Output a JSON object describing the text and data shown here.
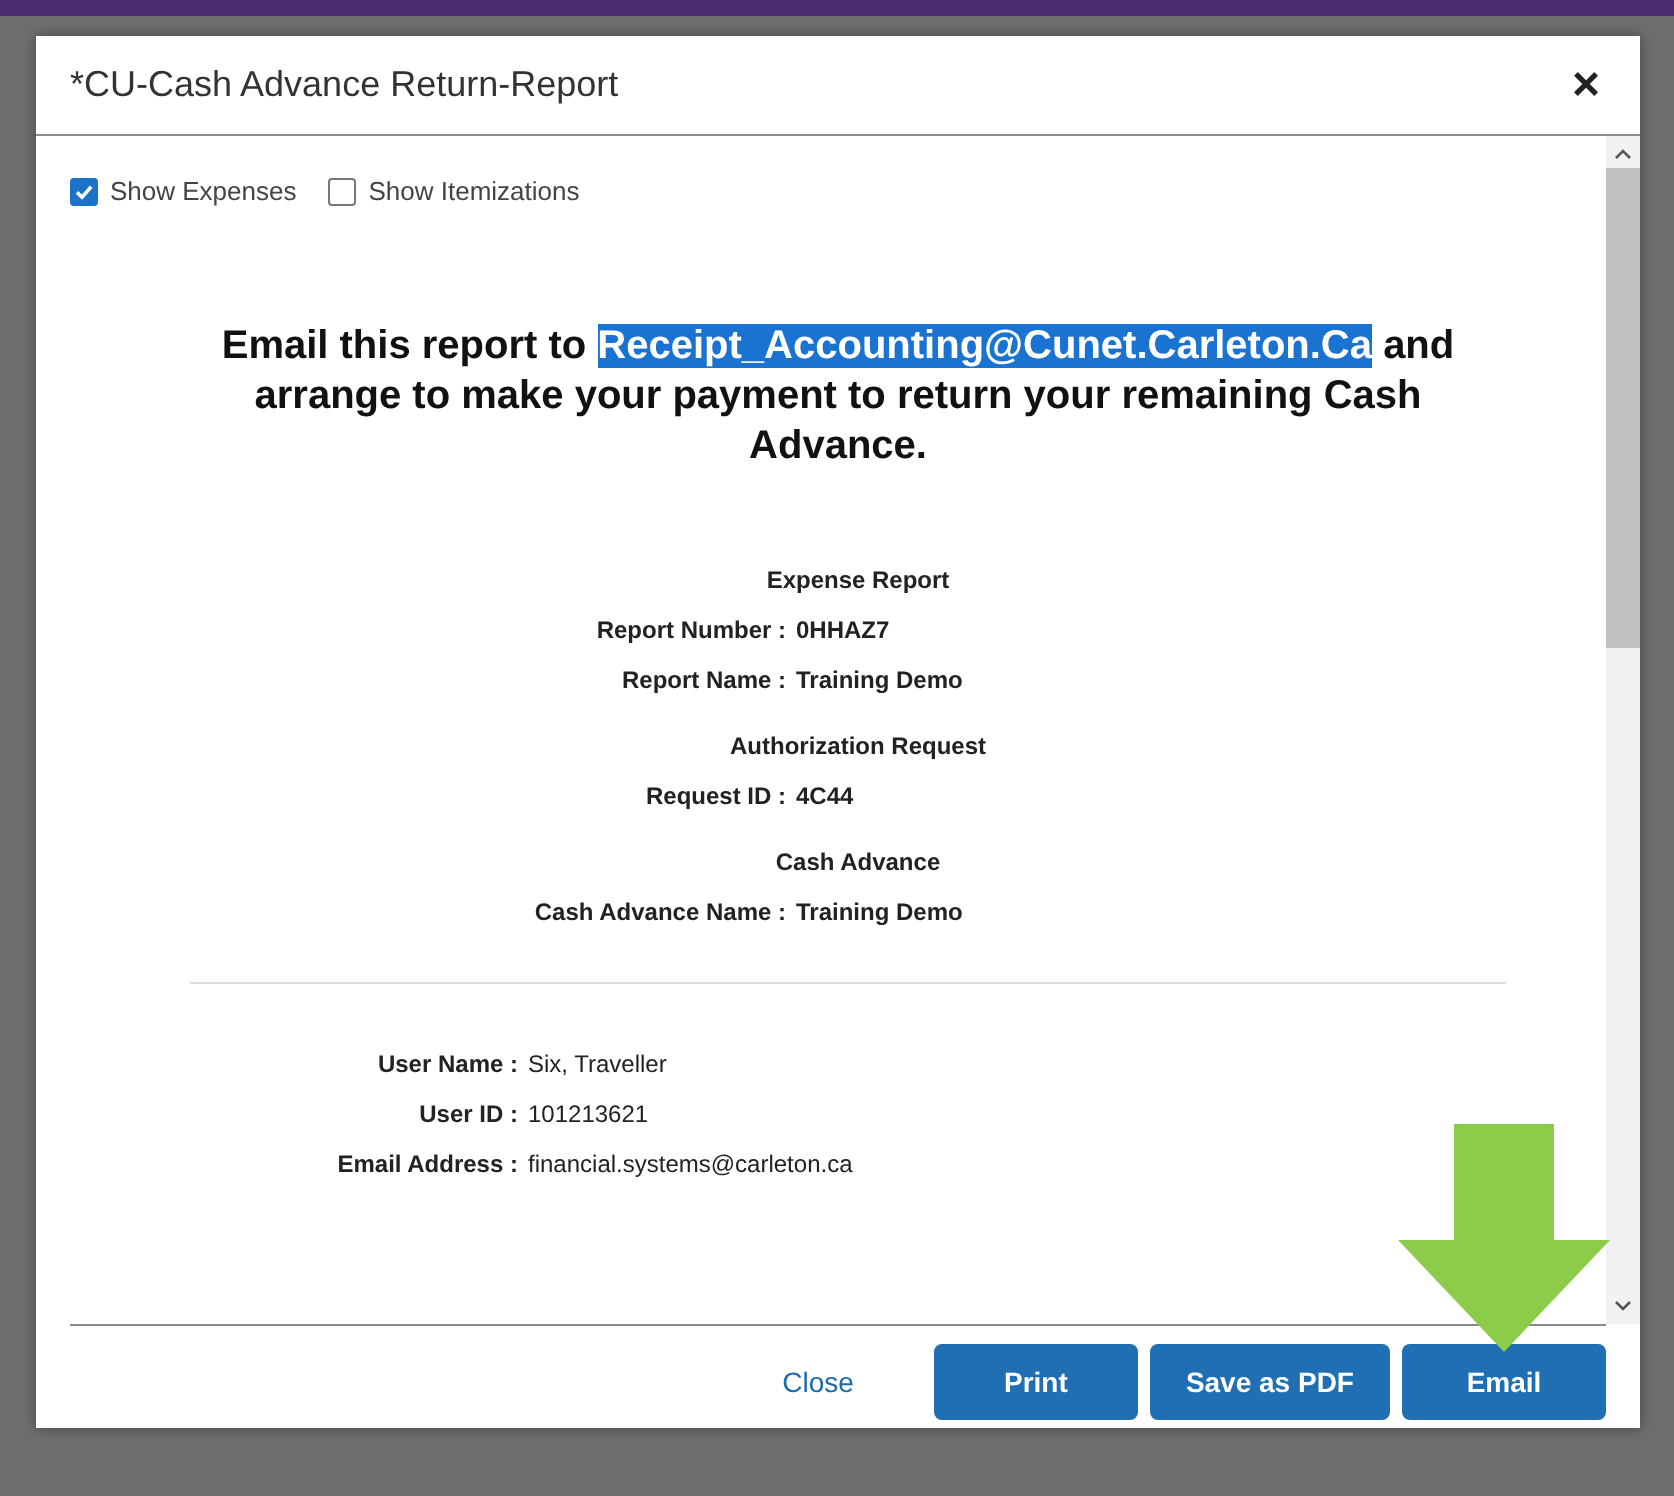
{
  "dialog": {
    "title": "*CU-Cash Advance Return-Report",
    "close": "×"
  },
  "options": [
    {
      "label": "Show Expenses",
      "checked": true
    },
    {
      "label": "Show Itemizations",
      "checked": false
    }
  ],
  "notice": {
    "before": "Email this report to",
    "highlighted": "Receipt_Accounting@Cunet.Carleton.Ca",
    "after": "and arrange to make your payment to return your remaining Cash Advance."
  },
  "report_sections": [
    {
      "title": "Expense Report",
      "fields": [
        {
          "label": "Report Number :",
          "value": "0HHAZ7"
        },
        {
          "label": "Report Name :",
          "value": "Training Demo"
        }
      ]
    },
    {
      "title": "Authorization Request",
      "fields": [
        {
          "label": "Request ID :",
          "value": "4C44"
        }
      ]
    },
    {
      "title": "Cash Advance",
      "fields": [
        {
          "label": "Cash Advance Name :",
          "value": "Training Demo"
        }
      ]
    }
  ],
  "user_fields": [
    {
      "label": "User Name :",
      "value": "Six, Traveller"
    },
    {
      "label": "User ID :",
      "value": "101213621"
    },
    {
      "label": "Email Address :",
      "value": "financial.systems@carleton.ca"
    }
  ],
  "footer": {
    "close": "Close",
    "buttons": [
      "Print",
      "Save as PDF",
      "Email"
    ]
  }
}
